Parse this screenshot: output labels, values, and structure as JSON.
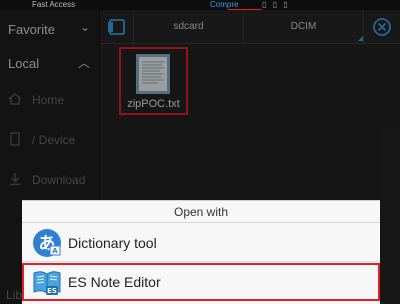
{
  "topbar": {
    "fast_access": "Fast Access",
    "active_tab": "Compre"
  },
  "sidebar": {
    "favorite": "Favorite",
    "local": "Local",
    "items": [
      {
        "label": "Home",
        "icon": "home-icon"
      },
      {
        "label": "/ Device",
        "icon": "phone-icon"
      },
      {
        "label": "Download",
        "icon": "download-icon"
      }
    ],
    "bottom_stub": "Lib"
  },
  "pathbar": {
    "crumbs": [
      "sdcard",
      "DCIM"
    ]
  },
  "files": [
    {
      "name": "zipPOC.txt",
      "icon": "text-file-icon"
    }
  ],
  "dialog": {
    "title": "Open with",
    "options": [
      {
        "label": "Dictionary tool",
        "icon": "dictionary-app-icon"
      },
      {
        "label": "ES Note Editor",
        "icon": "es-note-editor-icon"
      }
    ]
  },
  "colors": {
    "highlight": "#e21f26",
    "accent": "#3aa0e8",
    "dialog_bg": "#f7f7f7"
  }
}
